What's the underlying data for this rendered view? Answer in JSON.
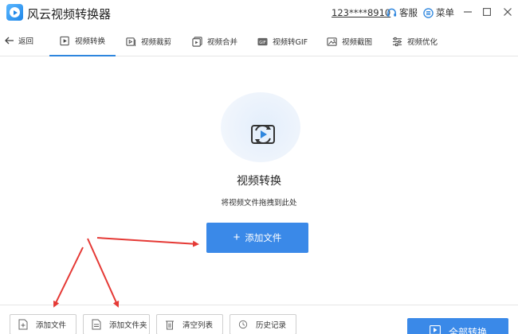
{
  "window": {
    "title": "风云视频转换器",
    "account": "123****8910",
    "service_label": "客服",
    "menu_label": "菜单"
  },
  "nav": {
    "back_label": "返回",
    "tabs": [
      {
        "label": "视频转换",
        "icon": "video-convert-icon",
        "active": true
      },
      {
        "label": "视频裁剪",
        "icon": "video-crop-icon",
        "active": false
      },
      {
        "label": "视频合并",
        "icon": "video-merge-icon",
        "active": false
      },
      {
        "label": "视频转GIF",
        "icon": "gif-icon",
        "active": false
      },
      {
        "label": "视频截图",
        "icon": "screenshot-icon",
        "active": false
      },
      {
        "label": "视频优化",
        "icon": "optimize-icon",
        "active": false
      }
    ]
  },
  "main": {
    "title": "视频转换",
    "subtitle": "将视频文件拖拽到此处",
    "add_button": "添加文件"
  },
  "bottom": {
    "add_file": "添加文件",
    "add_folder": "添加文件夹",
    "clear_list": "清空列表",
    "history": "历史记录",
    "convert_all": "全部转换"
  },
  "colors": {
    "accent": "#3a89e8",
    "annotation_arrow": "#e53935"
  }
}
